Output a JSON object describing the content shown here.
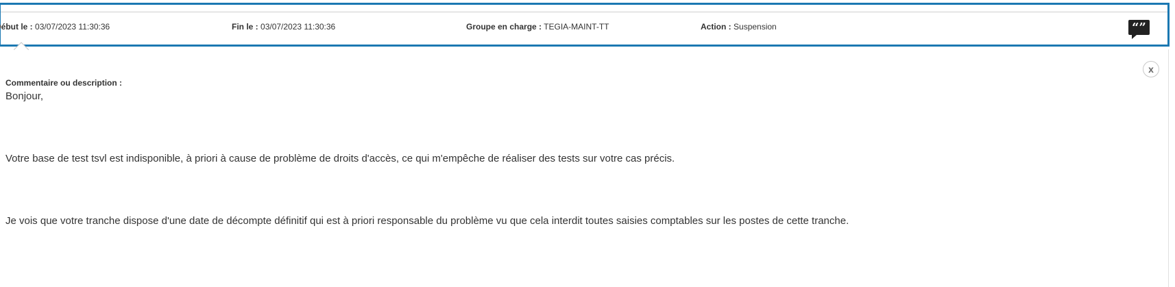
{
  "header": {
    "debut_label": "Début le :",
    "debut_value": "03/07/2023 11:30:36",
    "fin_label": "Fin le :",
    "fin_value": "03/07/2023 11:30:36",
    "groupe_label": "Groupe en charge :",
    "groupe_value": "TEGIA-MAINT-TT",
    "action_label": "Action :",
    "action_value": "Suspension",
    "quote_icon": "quote-icon"
  },
  "close_label": "x",
  "comment": {
    "label": "Commentaire ou description :",
    "paragraphs": [
      "Bonjour,",
      "Votre base de test tsvl est indisponible, à priori à cause de problème de droits d'accès, ce qui m'empêche de réaliser des tests sur votre cas précis.",
      "Je vois que votre tranche dispose d'une date de décompte définitif qui est à priori responsable du problème vu que cela interdit toutes saisies comptables sur les postes de cette tranche."
    ]
  },
  "colors": {
    "accent": "#1b78b2",
    "text": "#333333",
    "quote_bg": "#222222"
  }
}
